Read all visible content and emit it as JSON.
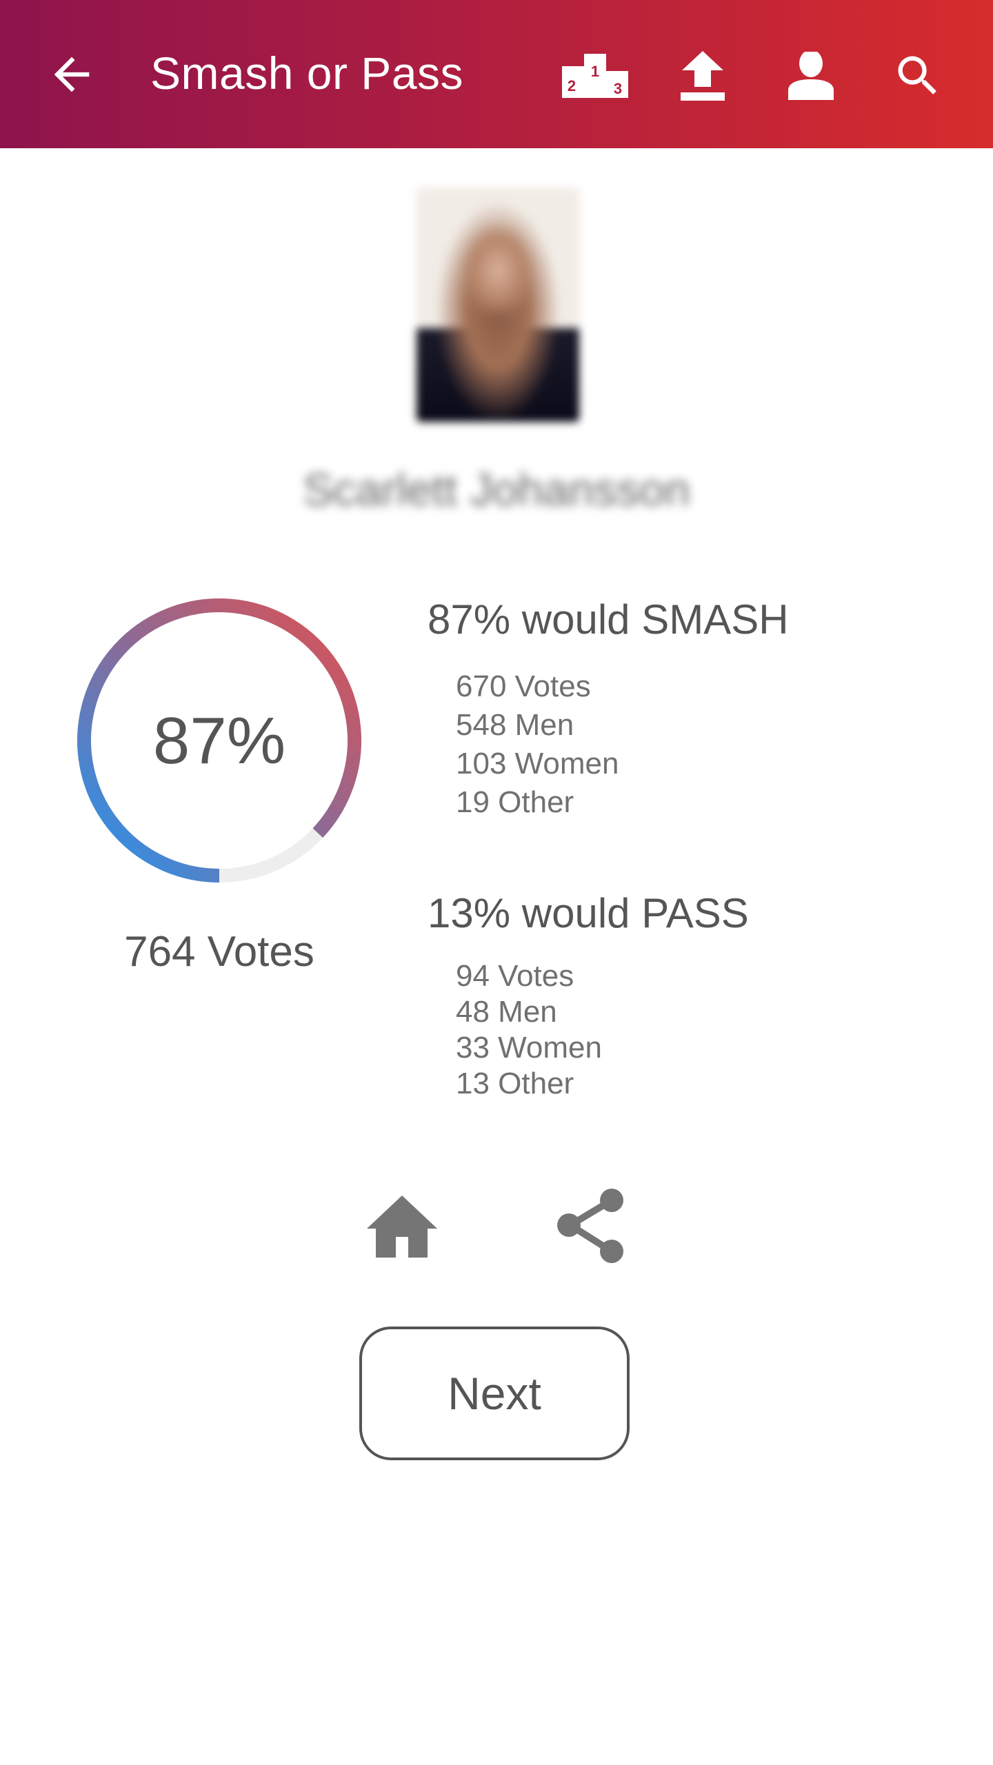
{
  "appbar": {
    "title_smash": "Smash",
    "title_or": "or",
    "title_pass": "Pass",
    "icons": [
      "back-arrow-icon",
      "leaderboard-podium-icon",
      "upload-icon",
      "profile-icon",
      "search-icon"
    ],
    "podium_labels": [
      "2",
      "1",
      "3"
    ],
    "gradient": [
      "#8e144c",
      "#d62c2c"
    ]
  },
  "profile": {
    "name": "Scarlett Johansson",
    "photo": "blurred portrait photo"
  },
  "result": {
    "percent_label": "87%",
    "smash_fraction": 0.87,
    "total_votes": "764 Votes",
    "ring_colors": {
      "start": "#2196f3",
      "end": "#e05050",
      "track": "#eeeeee"
    }
  },
  "smash": {
    "heading": "87% would SMASH",
    "items": [
      "670 Votes",
      "548 Men",
      "103 Women",
      "19 Other"
    ]
  },
  "pass": {
    "heading": "13% would PASS",
    "items": [
      "94 Votes",
      "48 Men",
      "33 Women",
      "13 Other"
    ]
  },
  "actions": {
    "home_icon": "home-icon",
    "share_icon": "share-icon",
    "next_label": "Next"
  }
}
